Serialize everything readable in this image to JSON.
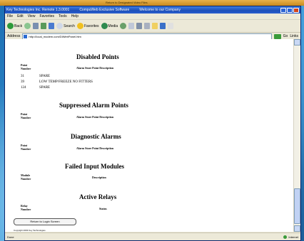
{
  "top_strip": {
    "text": "Return to Designated Video Files"
  },
  "window": {
    "title_segments": [
      "Key Technologies Inc. Remote 1.3.0001",
      "CompuWeb Exclusive Software",
      "Welcome to our Company"
    ],
    "menu": [
      "File",
      "Edit",
      "View",
      "Favorites",
      "Tools",
      "Help"
    ],
    "toolbar": {
      "back_label": "Back",
      "search_label": "Search",
      "favorites_label": "Favorites",
      "media_label": "Media"
    },
    "address": {
      "label": "Address",
      "url": "http://local_modem.com/DiWebPanel.htm",
      "go_label": "Go",
      "links_label": "Links"
    },
    "status": {
      "left": "Done",
      "zone": "Internet"
    },
    "colors": {
      "titlebar": "#2a5fd0",
      "chrome": "#ece9d8",
      "background": "#2f86c8"
    }
  },
  "page": {
    "sections": [
      {
        "id": "disabled",
        "heading": "Disabled Points",
        "col1": "Point\nNumber",
        "col2": "Alarm Store Point Description",
        "rows": [
          {
            "num": "31",
            "desc": "SPARE"
          },
          {
            "num": "39",
            "desc": "LOW TEMP/FREEZE NO FITTERS"
          },
          {
            "num": "124",
            "desc": "SPARE"
          }
        ]
      },
      {
        "id": "suppressed",
        "heading": "Suppressed Alarm Points",
        "col1": "Point\nNumber",
        "col2": "Alarm Store Point Description",
        "rows": []
      },
      {
        "id": "diagnostic",
        "heading": "Diagnostic Alarms",
        "col1": "Point\nNumber",
        "col2": "Alarm Store Point Description",
        "rows": []
      },
      {
        "id": "failed",
        "heading": "Failed Input Modules",
        "col1": "Module\nNumber",
        "col2": "Description",
        "rows": []
      },
      {
        "id": "relays",
        "heading": "Active Relays",
        "col1": "Relay\nNumber",
        "col2": "Status",
        "rows": []
      }
    ],
    "back_button": "Return to Login Screen",
    "copyright": "Copyright 2003 Key Technologies"
  }
}
